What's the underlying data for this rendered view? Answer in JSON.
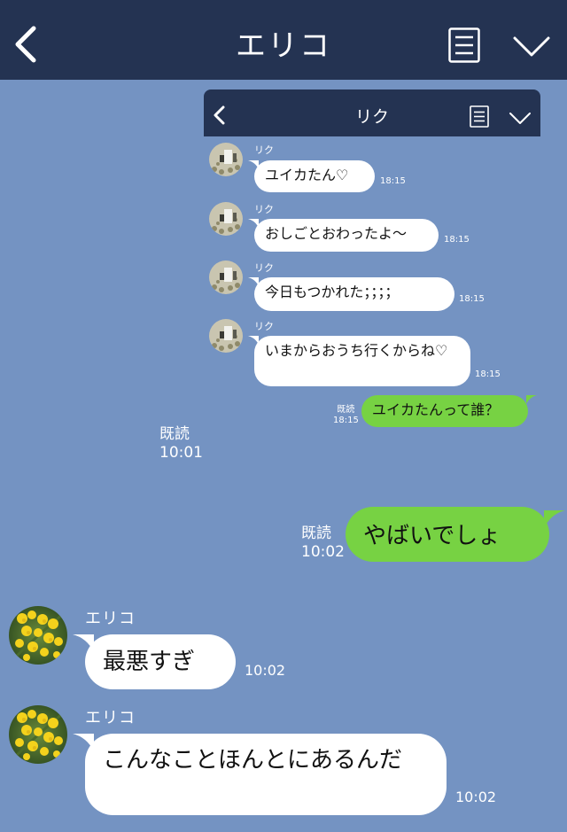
{
  "header": {
    "title": "エリコ",
    "back_icon": "chevron-left-icon",
    "menu_icon": "menu-icon",
    "collapse_icon": "chevron-down-icon"
  },
  "embedded": {
    "header": {
      "title": "リク"
    },
    "messages": [
      {
        "sender": "リク",
        "text": "ユイカたん♡",
        "time": "18:15"
      },
      {
        "sender": "リク",
        "text": "おしごとおわったよ〜",
        "time": "18:15"
      },
      {
        "sender": "リク",
        "text": "今日もつかれた；；；；",
        "time": "18:15"
      },
      {
        "sender": "リク",
        "text": "いまからおうち行くからね♡",
        "time": "18:15"
      }
    ],
    "outgoing": {
      "text": "ユイカたんって誰？",
      "read_label": "既読",
      "time": "18:15"
    }
  },
  "embedded_read": {
    "label": "既読",
    "time": "10:01"
  },
  "outgoing": {
    "text": "やばいでしょ",
    "read_label": "既読",
    "time": "10:02"
  },
  "incoming": [
    {
      "sender": "エリコ",
      "text": "最悪すぎ",
      "time": "10:02"
    },
    {
      "sender": "エリコ",
      "text": "こんなことほんとにあるんだ",
      "time": "10:02"
    }
  ],
  "colors": {
    "background": "#7493c2",
    "header": "#243352",
    "green_bubble": "#77d243",
    "white_bubble": "#ffffff"
  }
}
